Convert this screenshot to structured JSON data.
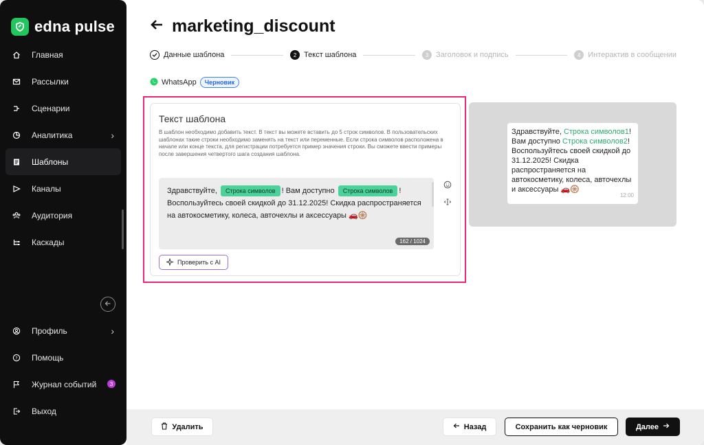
{
  "brand": {
    "name": "edna pulse",
    "accent": "#22c55e"
  },
  "sidebar": {
    "items": [
      {
        "label": "Главная",
        "icon": "home-icon"
      },
      {
        "label": "Рассылки",
        "icon": "mail-icon"
      },
      {
        "label": "Сценарии",
        "icon": "scenarios-icon"
      },
      {
        "label": "Аналитика",
        "icon": "analytics-icon",
        "has_submenu": true
      },
      {
        "label": "Шаблоны",
        "icon": "templates-icon",
        "active": true
      },
      {
        "label": "Каналы",
        "icon": "send-icon"
      },
      {
        "label": "Аудитория",
        "icon": "audience-icon"
      },
      {
        "label": "Каскады",
        "icon": "cascade-icon"
      }
    ],
    "bottom_items": [
      {
        "label": "Профиль",
        "icon": "profile-icon",
        "has_submenu": true
      },
      {
        "label": "Помощь",
        "icon": "help-icon"
      },
      {
        "label": "Журнал событий",
        "icon": "flag-icon",
        "badge": "3"
      },
      {
        "label": "Выход",
        "icon": "logout-icon"
      }
    ]
  },
  "header": {
    "title": "marketing_discount"
  },
  "steps": [
    {
      "num": "",
      "label": "Данные шаблона",
      "state": "done"
    },
    {
      "num": "2",
      "label": "Текст шаблона",
      "state": "current"
    },
    {
      "num": "3",
      "label": "Заголовок и подпись",
      "state": "todo"
    },
    {
      "num": "4",
      "label": "Интерактив в сообщении",
      "state": "todo"
    }
  ],
  "channel": {
    "name": "WhatsApp",
    "status": "Черновик"
  },
  "editor_card": {
    "title": "Текст шаблона",
    "description": "В шаблон необходимо добавить текст. В текст вы можете вставить до 5 строк символов. В пользовательских шаблонах такие строки необходимо заменять на текст или переменные. Если строка символов расположена в начале или конце текста, для регистрации потребуется пример значения строки. Вы сможете ввести примеры после завершения четвертого шага создания шаблона.",
    "text_part1": "Здравствуйте,",
    "variable_label": "Строка символов",
    "text_part2": "! Вам доступно",
    "text_part3": "! Воспользуйтесь своей скидкой до 31.12.2025! Скидка распространяется на автокосметику, колеса, авточехлы и аксессуары 🚗🛞",
    "counter": "162 / 1024",
    "ai_button": "Проверить с AI"
  },
  "preview": {
    "part1": "Здравствуйте, ",
    "var1": "Строка символов1",
    "part2": "! Вам доступно ",
    "var2": "Строка символов2",
    "part3": "! Воспользуйтесь своей скидкой до 31.12.2025! Скидка распространяется на автокосметику, колеса, авточехлы и аксессуары 🚗🛞",
    "time": "12:00"
  },
  "footer": {
    "delete": "Удалить",
    "back": "Назад",
    "save_draft": "Сохранить как черновик",
    "next": "Далее"
  }
}
